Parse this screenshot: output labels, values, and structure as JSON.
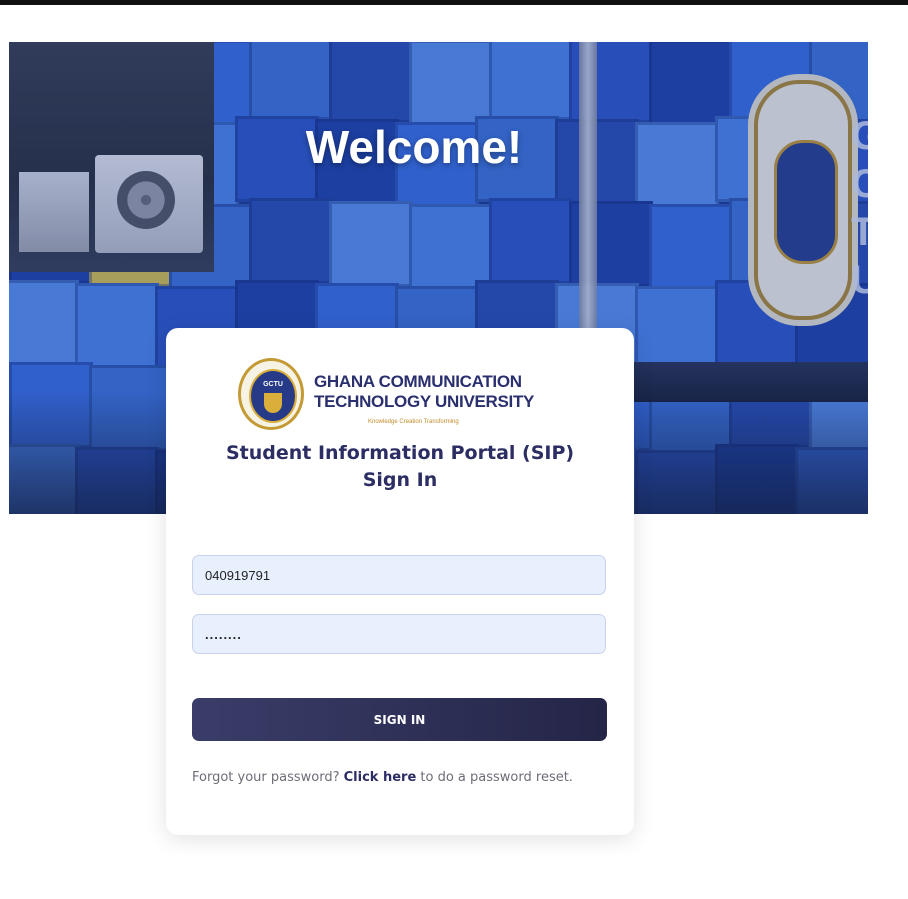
{
  "hero": {
    "welcome_text": "Welcome!",
    "emblem_text": "GCTU",
    "sign_letters": "G\nC\nT\nU"
  },
  "logo": {
    "seal_label": "GCTU",
    "name_line1": "GHANA COMMUNICATION",
    "name_line2": "TECHNOLOGY UNIVERSITY",
    "motto": "Knowledge Creation Transforming"
  },
  "portal": {
    "title_line1": "Student Information Portal (SIP)",
    "title_line2": "Sign In"
  },
  "form": {
    "username_value": "040919791",
    "password_value": "........",
    "submit_label": "SIGN IN"
  },
  "forgot": {
    "prefix": "Forgot your password? ",
    "link_text": "Click here",
    "suffix": " to do a password reset."
  },
  "colors": {
    "primary_dark": "#2b2d63",
    "button_start": "#3a3d69",
    "button_end": "#242547",
    "input_bg": "#e8f0fe",
    "hero_blue": "#1f3a8c"
  }
}
